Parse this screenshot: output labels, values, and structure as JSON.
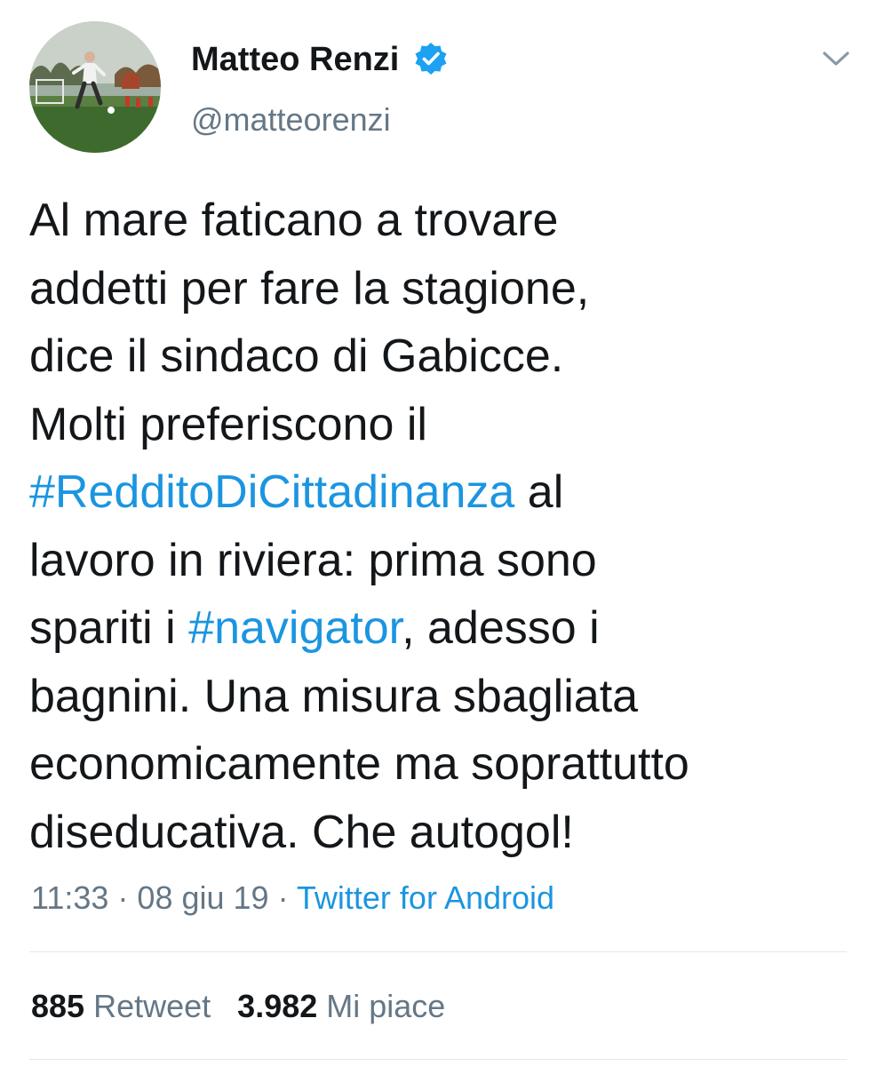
{
  "author": {
    "display_name": "Matteo Renzi",
    "handle": "@matteorenzi",
    "verified": true,
    "avatar_icon": "soccer-player-photo"
  },
  "tweet": {
    "lines": [
      [
        {
          "text": "Al mare faticano a trovare",
          "type": "text"
        }
      ],
      [
        {
          "text": "addetti per fare la stagione,",
          "type": "text"
        }
      ],
      [
        {
          "text": "dice il sindaco di Gabicce.",
          "type": "text"
        }
      ],
      [
        {
          "text": "Molti preferiscono il",
          "type": "text"
        }
      ],
      [
        {
          "text": "#RedditoDiCittadinanza",
          "type": "hashtag"
        },
        {
          "text": " al",
          "type": "text"
        }
      ],
      [
        {
          "text": "lavoro in riviera: prima sono",
          "type": "text"
        }
      ],
      [
        {
          "text": "spariti i ",
          "type": "text"
        },
        {
          "text": "#navigator",
          "type": "hashtag"
        },
        {
          "text": ", adesso i",
          "type": "text"
        }
      ],
      [
        {
          "text": "bagnini. Una misura sbagliata",
          "type": "text"
        }
      ],
      [
        {
          "text": "economicamente ma soprattutto",
          "type": "text"
        }
      ],
      [
        {
          "text": "diseducativa. Che autogol!",
          "type": "text"
        }
      ]
    ]
  },
  "meta": {
    "time": "11:33",
    "separator": " · ",
    "date": "08 giu 19",
    "source": "Twitter for Android"
  },
  "stats": {
    "retweets_count": "885",
    "retweets_label": "Retweet",
    "likes_count": "3.982",
    "likes_label": "Mi piace"
  },
  "colors": {
    "link": "#1b95e0",
    "secondary_text": "#657786",
    "primary_text": "#14171a",
    "verified_badge": "#1da1f2",
    "divider": "#e1e8ed"
  },
  "icons": {
    "verified": "verified-badge-icon",
    "more": "chevron-down-icon"
  }
}
